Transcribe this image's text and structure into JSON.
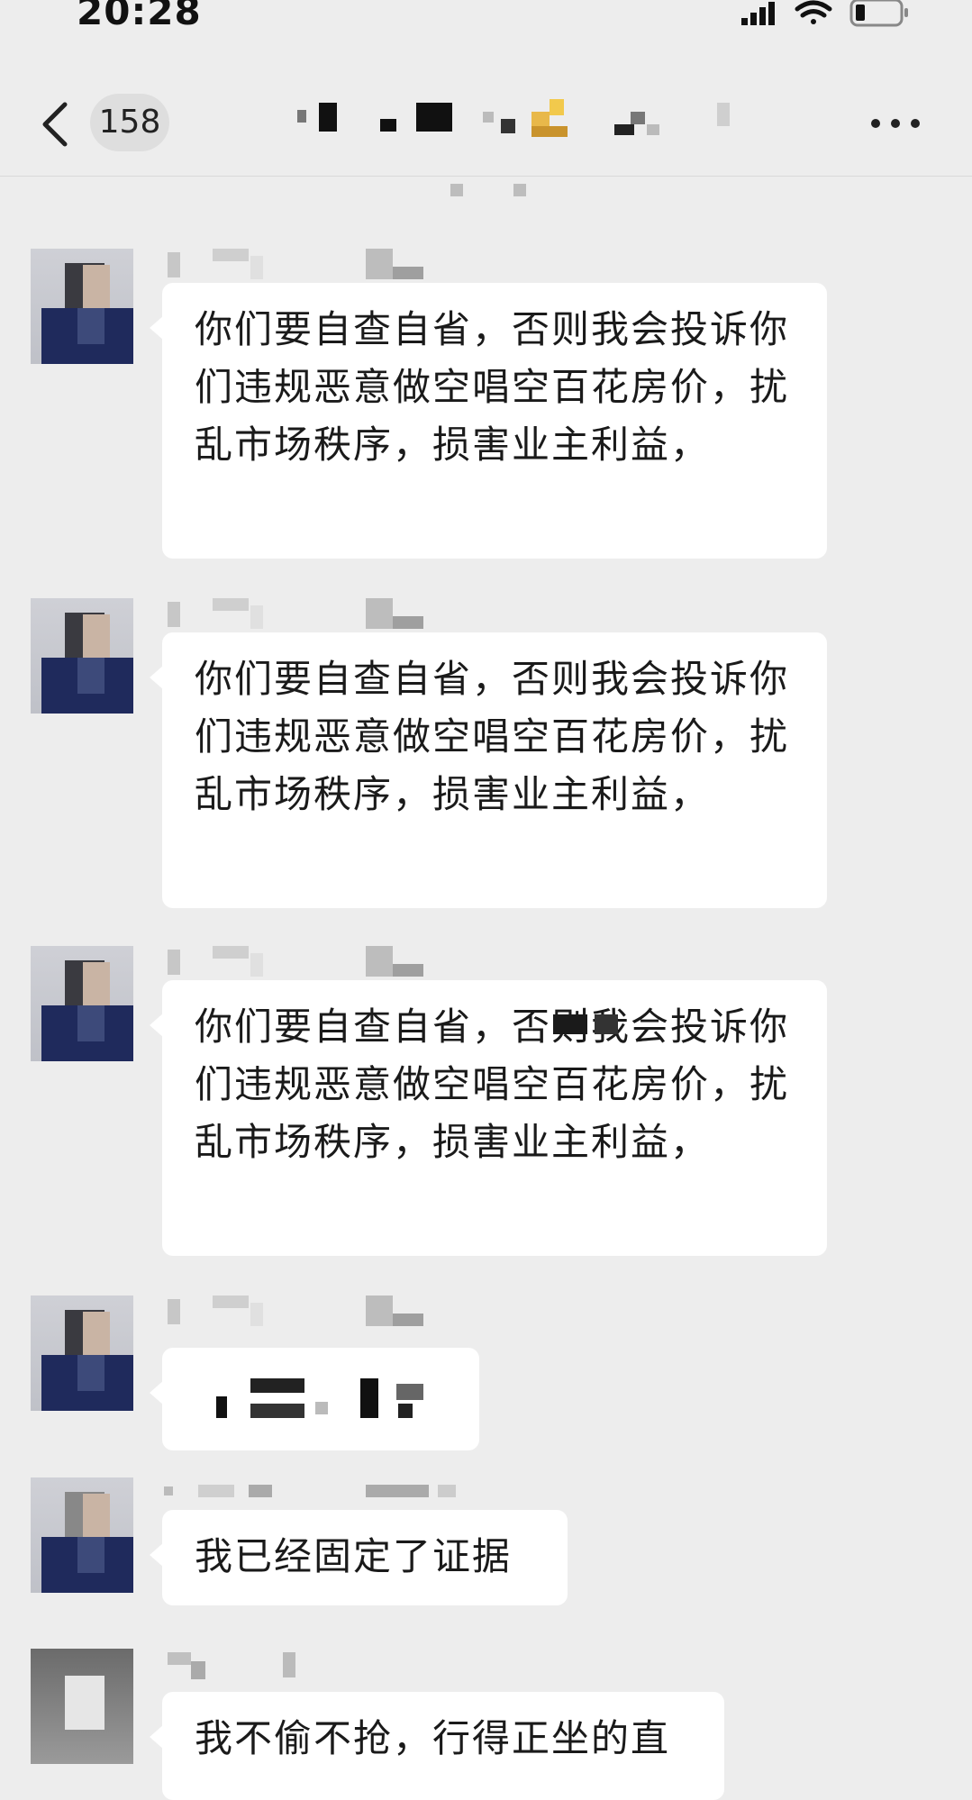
{
  "status_bar": {
    "time": "20:28"
  },
  "header": {
    "unread_count": "158"
  },
  "messages": [
    {
      "text": "你们要自查自省，否则我会投诉你们违规恶意做空唱空百花房价，扰乱市场秩序，损害业主利益，"
    },
    {
      "text": "你们要自查自省，否则我会投诉你们违规恶意做空唱空百花房价，扰乱市场秩序，损害业主利益，"
    },
    {
      "text": "你们要自查自省，否则我会投诉你们违规恶意做空唱空百花房价，扰乱市场秩序，损害业主利益，"
    },
    {
      "text": ""
    },
    {
      "text": "我已经固定了证据"
    },
    {
      "text": "我不偷不抢，行得正坐的直"
    }
  ]
}
